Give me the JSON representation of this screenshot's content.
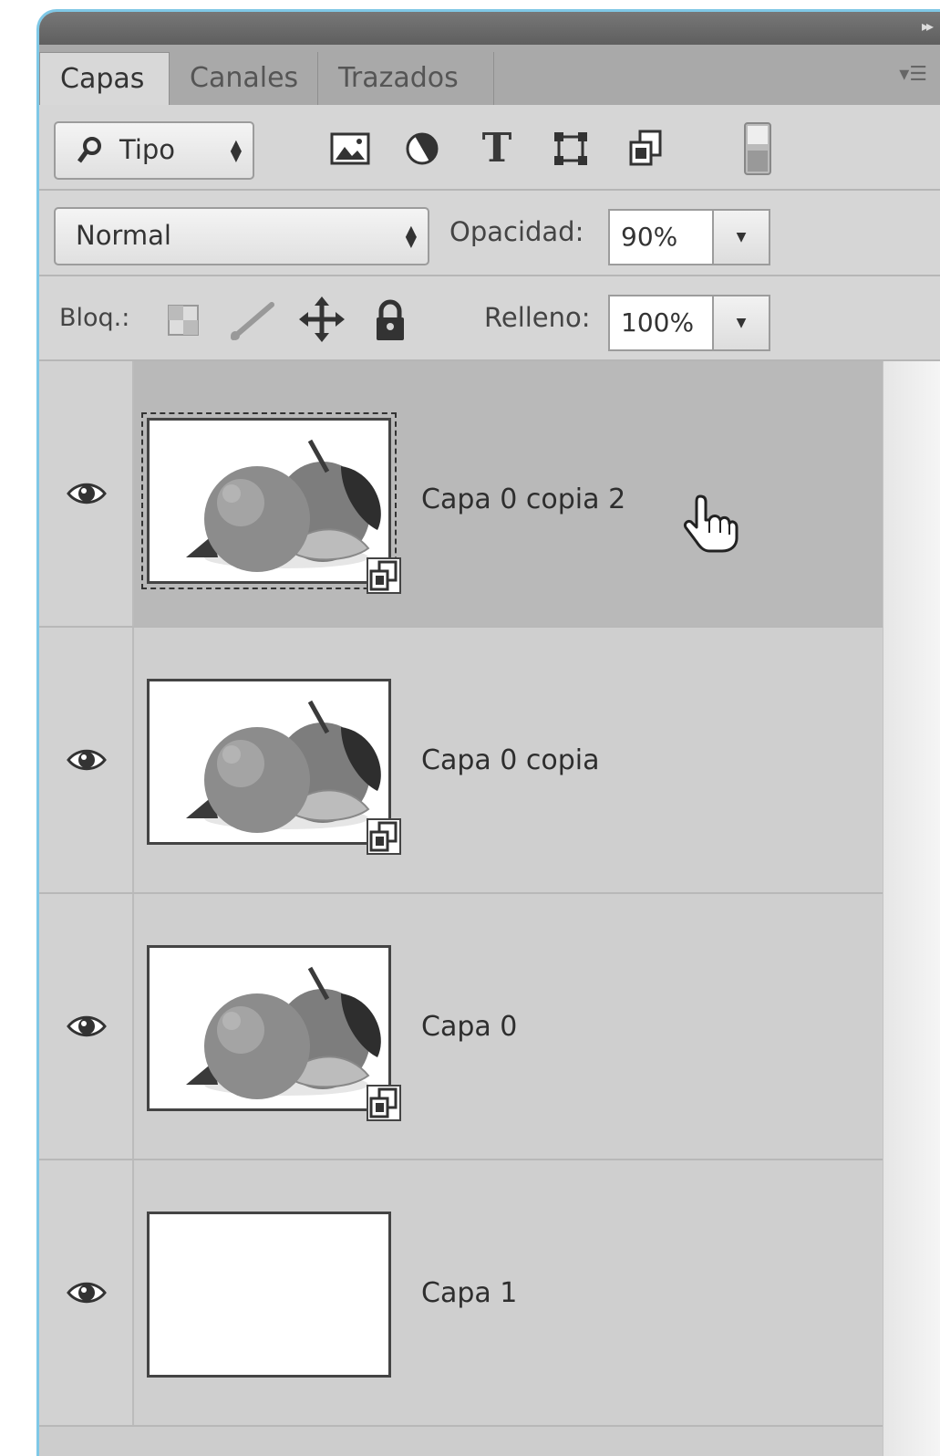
{
  "tabs": [
    "Capas",
    "Canales",
    "Trazados"
  ],
  "filter": {
    "value": "Tipo"
  },
  "blend": {
    "mode": "Normal",
    "opacity_label": "Opacidad:",
    "opacity_value": "90%"
  },
  "lock": {
    "label": "Bloq.:",
    "fill_label": "Relleno:",
    "fill_value": "100%"
  },
  "layers": [
    {
      "name": "Capa 0 copia 2",
      "selected": true,
      "thumbnail": "fruit"
    },
    {
      "name": "Capa 0 copia",
      "selected": false,
      "thumbnail": "fruit"
    },
    {
      "name": "Capa 0",
      "selected": false,
      "thumbnail": "fruit"
    },
    {
      "name": "Capa 1",
      "selected": false,
      "thumbnail": "blank"
    }
  ]
}
